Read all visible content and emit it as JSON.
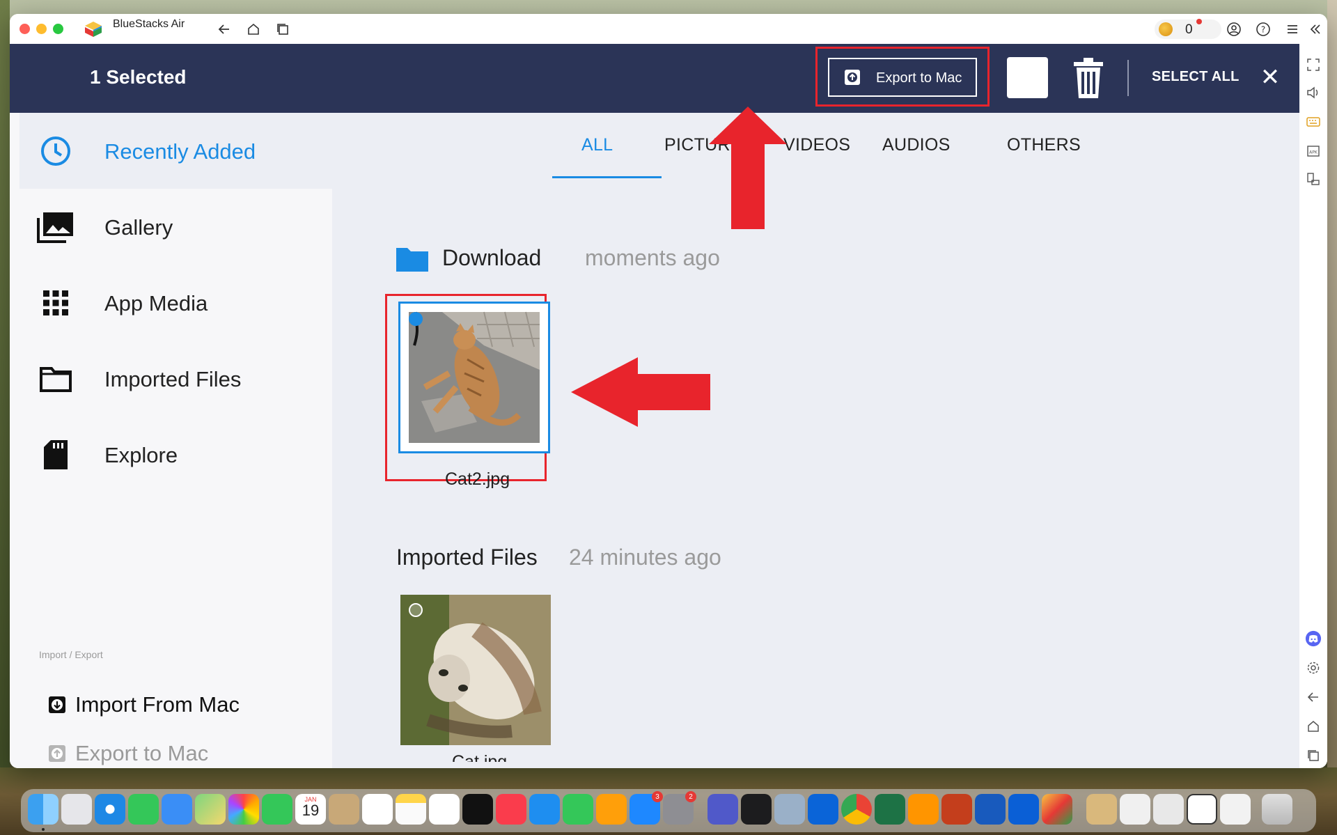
{
  "window": {
    "app_title": "BlueStacks Air",
    "coins": "0"
  },
  "header": {
    "selected_label": "1 Selected",
    "export_label": "Export to Mac",
    "select_all_label": "SELECT ALL",
    "close_glyph": "✕"
  },
  "sidebar": {
    "items": [
      {
        "label": "Recently Added",
        "icon": "clock-icon"
      },
      {
        "label": "Gallery",
        "icon": "gallery-icon"
      },
      {
        "label": "App Media",
        "icon": "grid-icon"
      },
      {
        "label": "Imported Files",
        "icon": "folder-icon"
      },
      {
        "label": "Explore",
        "icon": "sd-card-icon"
      }
    ],
    "section_label": "Import / Export",
    "import_label": "Import From Mac",
    "export_label": "Export to Mac"
  },
  "tabs": {
    "all": "ALL",
    "pictures": "PICTURES",
    "videos": "VIDEOS",
    "audios": "AUDIOS",
    "others": "OTHERS"
  },
  "groups": [
    {
      "title": "Download",
      "time": "moments ago",
      "files": [
        {
          "name": "Cat2.jpg",
          "selected": true
        }
      ]
    },
    {
      "title": "Imported Files",
      "time": "24 minutes ago",
      "files": [
        {
          "name": "Cat.jpg",
          "selected": false
        }
      ]
    }
  ],
  "dock": {
    "calendar_month": "JAN",
    "calendar_day": "19",
    "badge_appstore": "3",
    "badge_settings": "2"
  },
  "colors": {
    "header": "#2b3457",
    "accent": "#1a8be3",
    "highlight_red": "#e8242c"
  }
}
